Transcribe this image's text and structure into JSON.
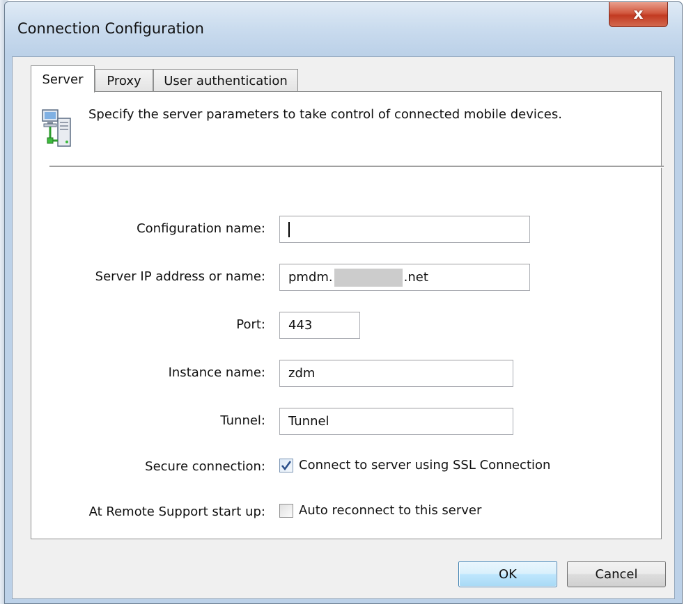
{
  "window": {
    "title": "Connection Configuration",
    "close_glyph": "x"
  },
  "tabs": [
    {
      "label": "Server",
      "active": true
    },
    {
      "label": "Proxy",
      "active": false
    },
    {
      "label": "User authentication",
      "active": false
    }
  ],
  "panel": {
    "icon": "server-network-icon",
    "description": "Specify the server parameters to take control of connected mobile devices."
  },
  "form": {
    "config_name": {
      "label": "Configuration name:",
      "value": ""
    },
    "server_ip": {
      "label": "Server IP address or name:",
      "prefix": "pmdm.",
      "suffix": ".net"
    },
    "port": {
      "label": "Port:",
      "value": "443"
    },
    "instance": {
      "label": "Instance name:",
      "value": "zdm"
    },
    "tunnel": {
      "label": "Tunnel:",
      "value": "Tunnel"
    },
    "secure": {
      "label": "Secure connection:",
      "checkbox_label": "Connect to server using SSL Connection",
      "checked": true
    },
    "startup": {
      "label": "At Remote Support start up:",
      "checkbox_label": "Auto reconnect to this server",
      "checked": false
    }
  },
  "buttons": {
    "ok": "OK",
    "cancel": "Cancel"
  },
  "colors": {
    "close_button": "#c23a22",
    "default_button_border": "#3c7fb1",
    "checkmark": "#2b4f8a"
  }
}
